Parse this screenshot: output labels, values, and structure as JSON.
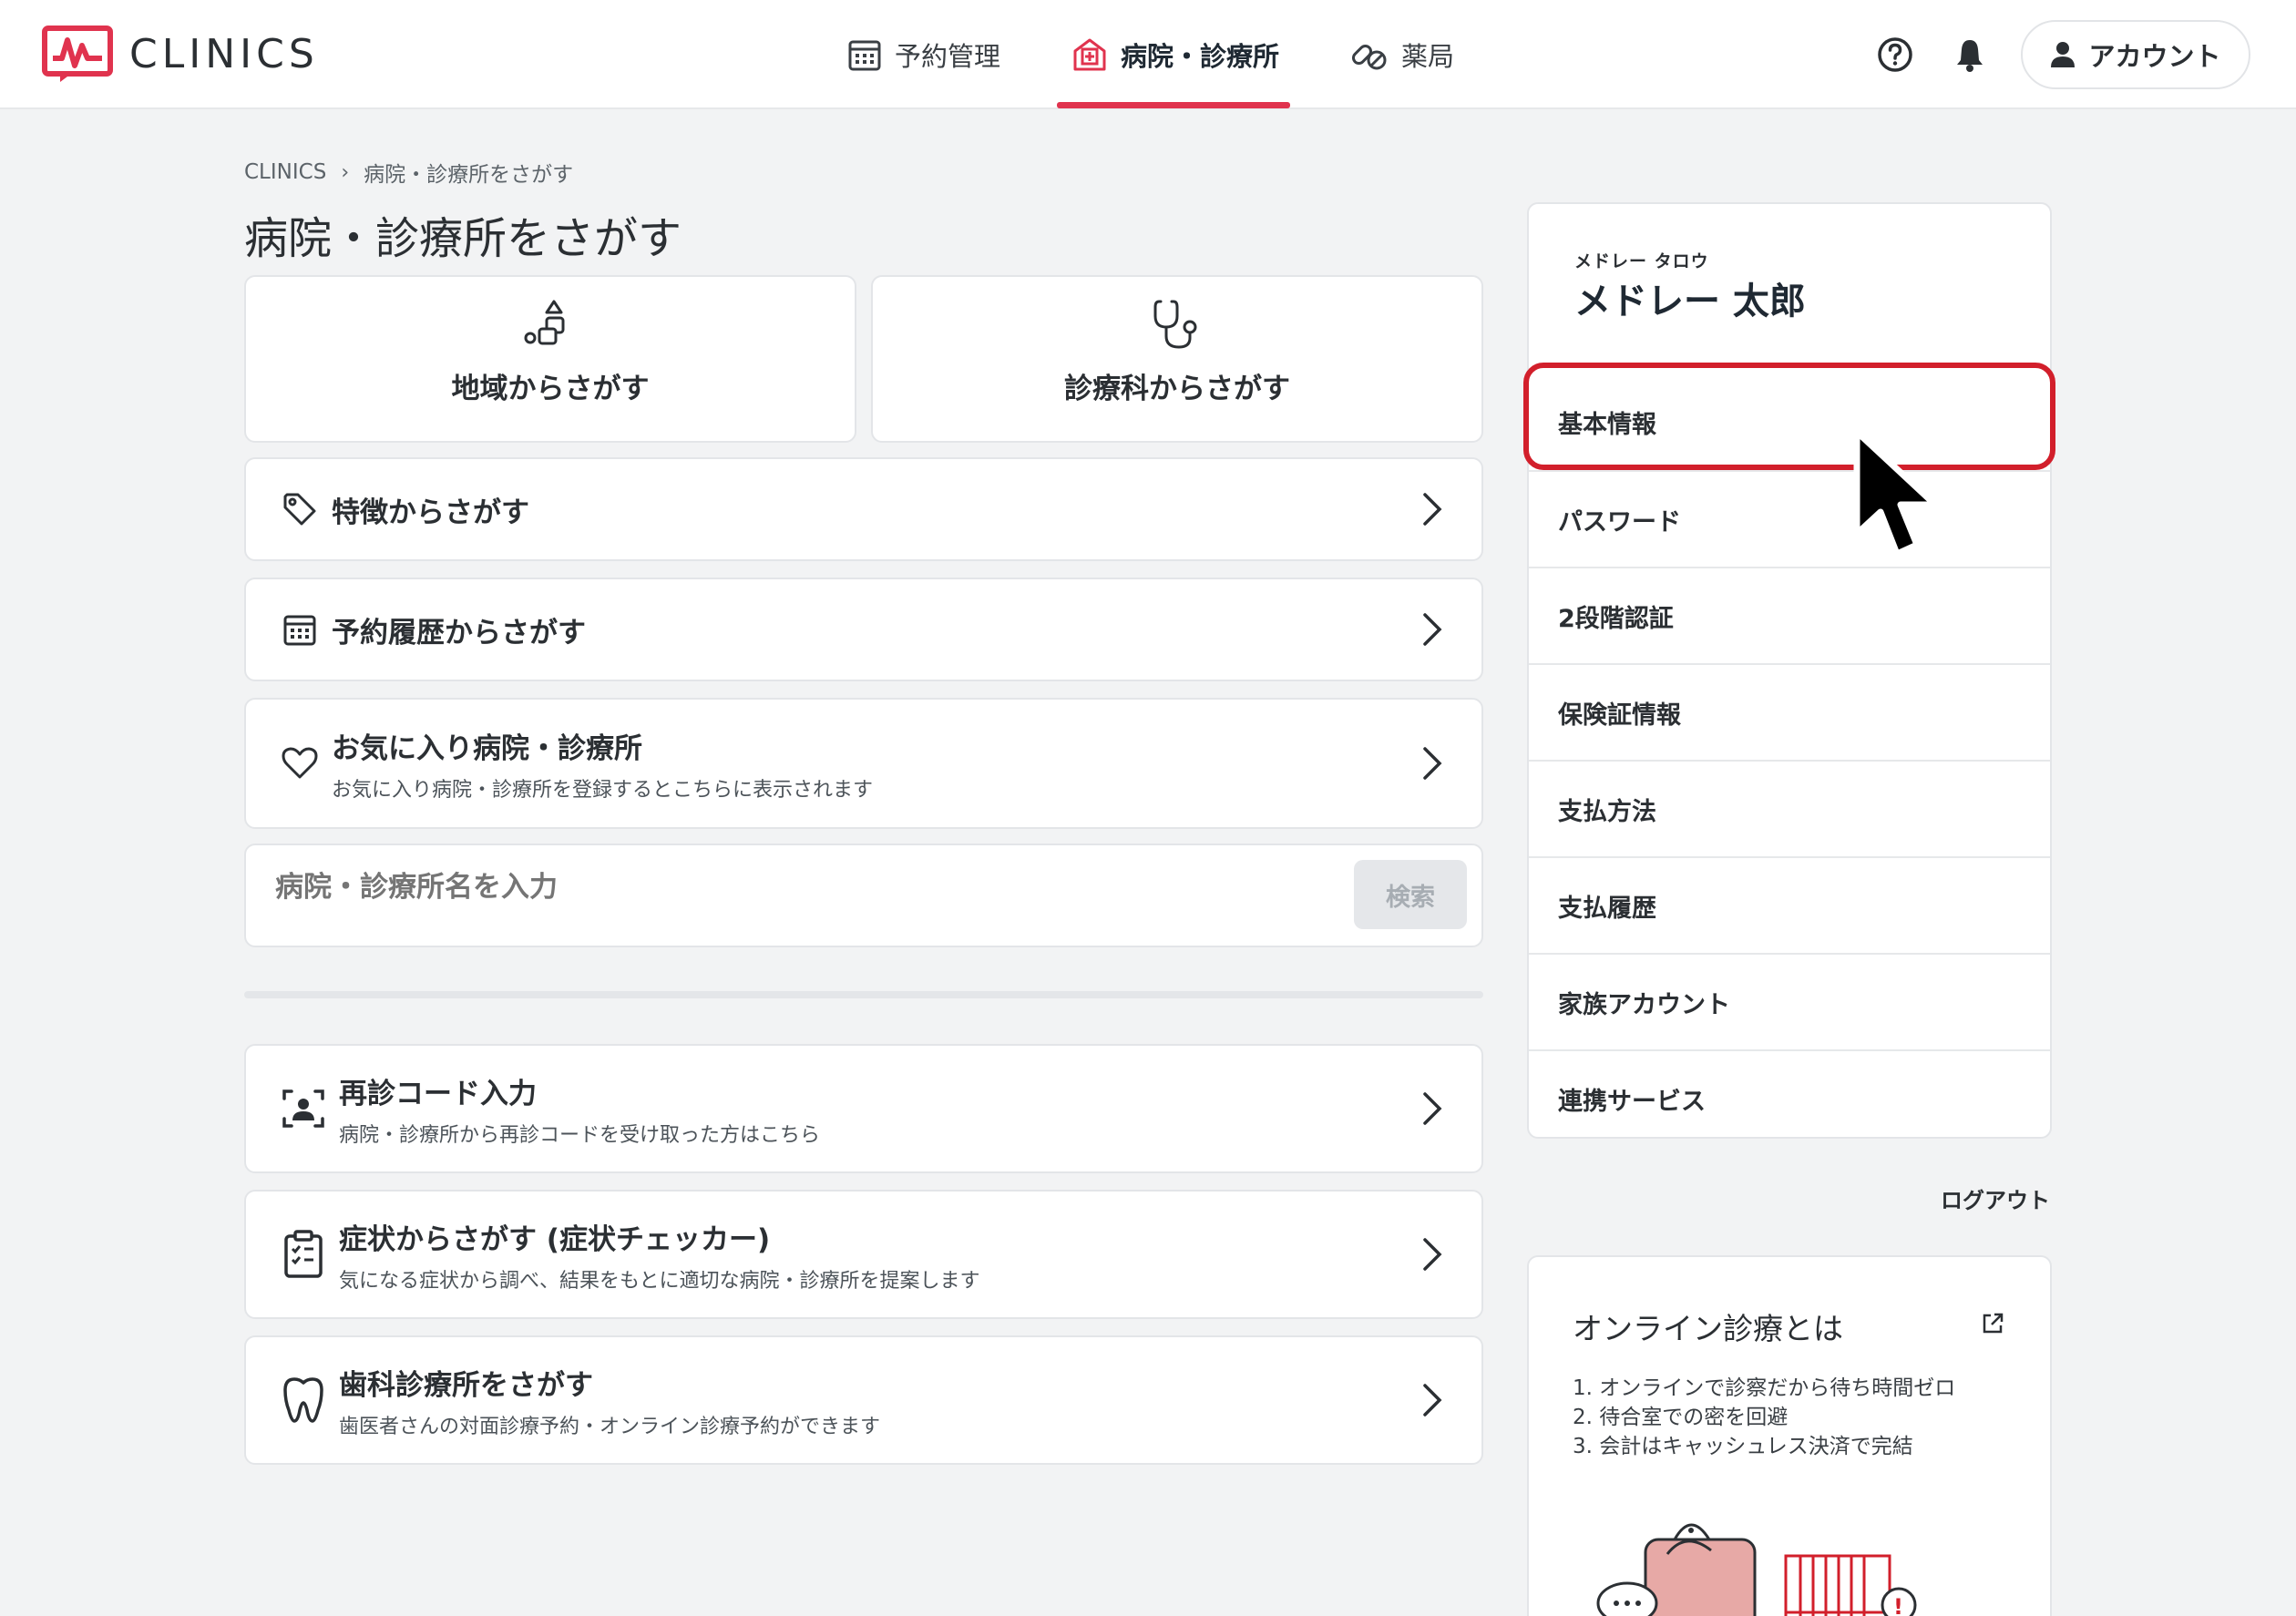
{
  "brand": {
    "name": "CLINICS",
    "accent": "#e0334e"
  },
  "header": {
    "nav": [
      {
        "label": "予約管理",
        "icon": "calendar-icon",
        "active": false
      },
      {
        "label": "病院・診療所",
        "icon": "hospital-icon",
        "active": true
      },
      {
        "label": "薬局",
        "icon": "pills-icon",
        "active": false
      }
    ],
    "help_icon": "help-icon",
    "bell_icon": "bell-icon",
    "account_label": "アカウント"
  },
  "breadcrumb": {
    "root": "CLINICS",
    "current": "病院・診療所をさがす"
  },
  "page_title": "病院・診療所をさがす",
  "tiles": {
    "region": "地域からさがす",
    "department": "診療科からさがす"
  },
  "rows": {
    "features": {
      "title": "特徴からさがす"
    },
    "history": {
      "title": "予約履歴からさがす"
    },
    "favorites": {
      "title": "お気に入り病院・診療所",
      "sub": "お気に入り病院・診療所を登録するとこちらに表示されます"
    }
  },
  "search": {
    "placeholder": "病院・診療所名を入力",
    "button": "検索"
  },
  "extra_rows": {
    "revisit": {
      "title": "再診コード入力",
      "sub": "病院・診療所から再診コードを受け取った方はこちら"
    },
    "symptoms": {
      "title": "症状からさがす (症状チェッカー)",
      "sub": "気になる症状から調べ、結果をもとに適切な病院・診療所を提案します"
    },
    "dental": {
      "title": "歯科診療所をさがす",
      "sub": "歯医者さんの対面診療予約・オンライン診療予約ができます"
    }
  },
  "profile": {
    "kana": "メドレー タロウ",
    "name": "メドレー 太郎",
    "menu": [
      "基本情報",
      "パスワード",
      "2段階認証",
      "保険証情報",
      "支払方法",
      "支払履歴",
      "家族アカウント",
      "連携サービス"
    ],
    "highlighted": "基本情報",
    "highlight_color": "#d21f2b"
  },
  "logout": "ログアウト",
  "online_info": {
    "title": "オンライン診療とは",
    "items": [
      "1. オンラインで診察だから待ち時間ゼロ",
      "2. 待合室での密を回避",
      "3. 会計はキャッシュレス決済で完結"
    ]
  }
}
